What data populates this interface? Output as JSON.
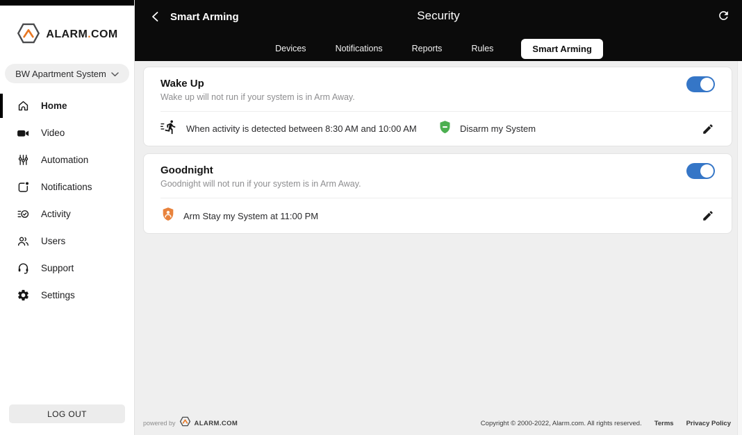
{
  "colors": {
    "accent_blue": "#3576C7",
    "disarm_green": "#4CAF50",
    "arm_stay_orange": "#E8823C",
    "header_black": "#0B0B0B",
    "content_bg": "#EFEFEF",
    "logo_orange": "#E87722"
  },
  "sidebar": {
    "logo": {
      "brand": "ALARM",
      "dot": ".",
      "brand2": "COM",
      "icon": "alarm-hexagon-logo"
    },
    "system_selector": {
      "label": "BW Apartment System",
      "icon": "chevron-down-icon"
    },
    "items": [
      {
        "label": "Home",
        "icon": "home-icon",
        "active": true
      },
      {
        "label": "Video",
        "icon": "video-camera-icon",
        "active": false
      },
      {
        "label": "Automation",
        "icon": "sliders-icon",
        "active": false
      },
      {
        "label": "Notifications",
        "icon": "notification-square-icon",
        "active": false
      },
      {
        "label": "Activity",
        "icon": "activity-check-icon",
        "active": false
      },
      {
        "label": "Users",
        "icon": "users-icon",
        "active": false
      },
      {
        "label": "Support",
        "icon": "headset-icon",
        "active": false
      },
      {
        "label": "Settings",
        "icon": "gear-icon",
        "active": false
      }
    ],
    "logout_label": "LOG OUT"
  },
  "header": {
    "back": {
      "icon": "chevron-left-icon",
      "label": "Smart Arming"
    },
    "title": "Security",
    "refresh_icon": "refresh-icon",
    "tabs": [
      {
        "label": "Devices",
        "active": false
      },
      {
        "label": "Notifications",
        "active": false
      },
      {
        "label": "Reports",
        "active": false
      },
      {
        "label": "Rules",
        "active": false
      },
      {
        "label": "Smart Arming",
        "active": true
      }
    ]
  },
  "scenes": [
    {
      "title": "Wake Up",
      "description": "Wake up will not run if your system is in Arm Away.",
      "enabled": true,
      "trigger": {
        "icon": "running-person-icon",
        "text": "When activity is detected between 8:30 AM and 10:00 AM"
      },
      "action": {
        "icon": "disarm-shield-icon",
        "text": "Disarm my System"
      }
    },
    {
      "title": "Goodnight",
      "description": "Goodnight will not run if your system is in Arm Away.",
      "enabled": true,
      "trigger": {
        "icon": "arm-stay-shield-icon",
        "text": "Arm Stay my System at 11:00 PM"
      }
    }
  ],
  "footer": {
    "powered_by": "powered by",
    "logo_text": "ALARM.COM",
    "copyright": "Copyright © 2000-2022, Alarm.com. All rights reserved.",
    "links": [
      {
        "label": "Terms"
      },
      {
        "label": "Privacy Policy"
      }
    ]
  }
}
